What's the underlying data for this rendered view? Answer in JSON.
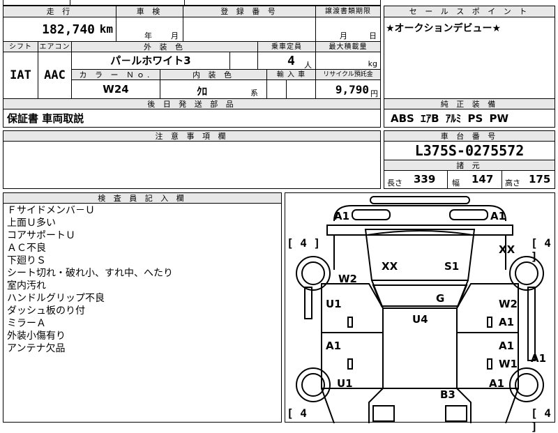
{
  "top": {
    "mileage_label": "走 行",
    "mileage_value": "182,740",
    "mileage_unit": "km",
    "inspection_label": "車 検",
    "inspection_year": "年",
    "inspection_month": "月",
    "reg_label": "登 録 番 号",
    "transfer_label": "譲渡書類期限",
    "transfer_month": "月",
    "transfer_day": "日"
  },
  "sales_point": {
    "label": "セ ー ル ス ポ イ ン ト",
    "text": "★オークションデビュー★"
  },
  "shift": {
    "label": "シフト",
    "value": "IAT"
  },
  "aircon": {
    "label": "エアコン",
    "value": "AAC"
  },
  "exterior": {
    "label": "外 装 色",
    "value": "パ－ルホワイト3"
  },
  "capacity": {
    "label": "乗車定員",
    "value": "4",
    "unit": "人"
  },
  "load": {
    "label": "最大積載量",
    "unit": "kg"
  },
  "color_no": {
    "label": "カ ラ ー Ｎｏ.",
    "value": "W24"
  },
  "interior": {
    "label": "内 装 色",
    "value": "ｸﾛ",
    "suffix": "系"
  },
  "import": {
    "label": "輸 入 車"
  },
  "recycle": {
    "label": "リサイクル預託金",
    "value": "9,790",
    "unit": "円"
  },
  "parts": {
    "label": "後 日 発 送 部 品",
    "value": "保証書 車両取説"
  },
  "equipment": {
    "label": "純 正 装 備",
    "value": "ABS ｴｱB ｱﾙﾐ PS PW"
  },
  "caution": {
    "label": "注 意 事 項 欄"
  },
  "chassis": {
    "label": "車 台 番 号",
    "value": "L375S-0275572"
  },
  "specs": {
    "label": "諸 元",
    "length_label": "長さ",
    "length": "339",
    "width_label": "幅",
    "width": "147",
    "height_label": "高さ",
    "height": "175"
  },
  "inspector": {
    "label": "検 査 員 記 入 欄",
    "notes": [
      "Ｆサイドメンバ－Ｕ",
      "上面Ｕ多い",
      "コアサポートＵ",
      "ＡＣ不良",
      "下廻りＳ",
      "シート切れ・破れ小、すれ中、へたり",
      "室内汚れ",
      "ハンドルグリップ不良",
      "ダッシュ板のり付",
      "ミラーＡ",
      "外装小傷有り",
      "アンテナ欠品"
    ]
  },
  "diagram": {
    "codes": {
      "front_bumper_l": "A1",
      "front_bumper_r": "A1",
      "fender_fl": "W2",
      "hood_l": "XX",
      "hood_r": "S1",
      "fender_fr": "XX",
      "roof": "U4",
      "windshield": "G",
      "door_fl": "U1",
      "door_fr_1": "W2",
      "door_fr_2": "A1",
      "door_rl": "A1",
      "door_rr_1": "A1",
      "door_rr_2": "W1",
      "side_r": "A1",
      "quarter_l": "U1",
      "quarter_r": "A1",
      "back": "B3"
    },
    "tires": {
      "fl": "[ 4 ]",
      "fr": "[ 4 ]",
      "rl": "[ 4",
      "rr": "[ 4 ]"
    }
  }
}
